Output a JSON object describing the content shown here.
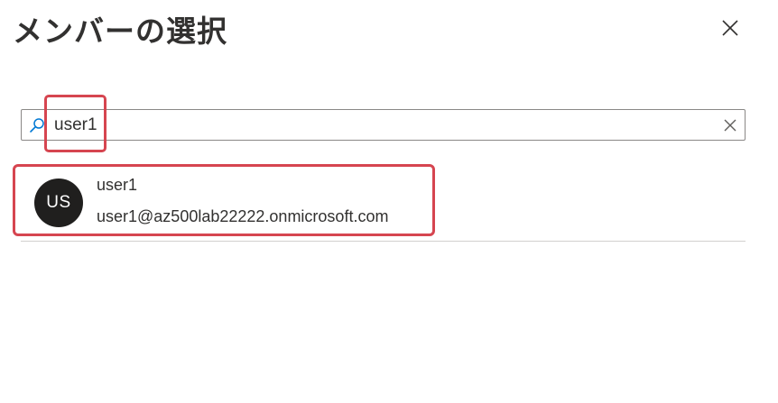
{
  "panel": {
    "title": "メンバーの選択"
  },
  "search": {
    "value": "user1",
    "placeholder": ""
  },
  "results": [
    {
      "initials": "US",
      "name": "user1",
      "email": "user1@az500lab22222.onmicrosoft.com"
    }
  ],
  "colors": {
    "highlight": "#d64550",
    "avatar_bg": "#201f1e",
    "search_icon": "#0078d4",
    "text": "#323130"
  },
  "icons": {
    "close": "close-icon",
    "search": "search-icon",
    "clear": "clear-icon"
  }
}
